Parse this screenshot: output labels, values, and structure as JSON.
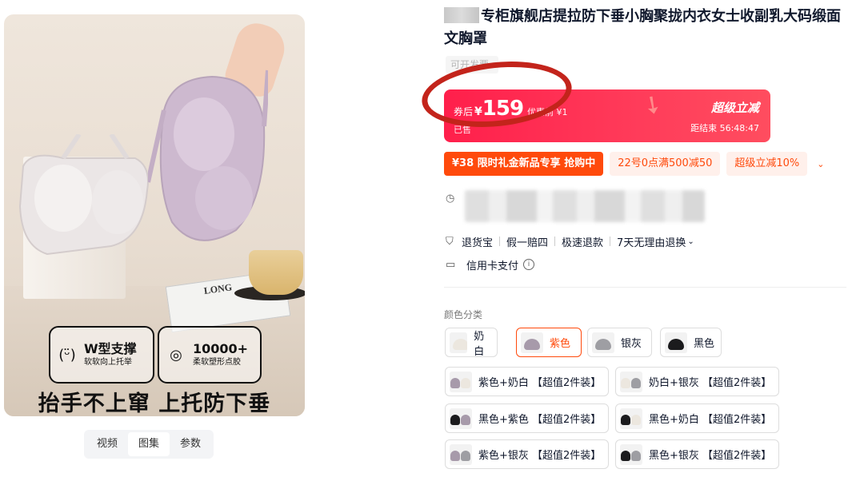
{
  "product": {
    "title": "专柜旗舰店提拉防下垂小胸聚拢内衣女士收副乳大码缎面文胸罩",
    "tag": "可开发票"
  },
  "gallery": {
    "feature1_title": "W型支撑",
    "feature1_sub": "软软向上托举",
    "feature2_title": "10000+",
    "feature2_sub": "柔软塑形点胶",
    "headline": "抬手不上窜  上托防下垂",
    "paper_text": "LONG",
    "tabs": [
      {
        "label": "视频"
      },
      {
        "label": "图集"
      },
      {
        "label": "参数"
      }
    ]
  },
  "price": {
    "after_label": "券后",
    "currency": "¥",
    "value": "159",
    "before_label": "优惠前 ¥1",
    "sold_text": "已售",
    "brand": "超级立减",
    "countdown": "距结束 56:48:47"
  },
  "promos": [
    {
      "label": "¥38  限时礼金新品专享 抢购中",
      "style": "solid"
    },
    {
      "label": "22号0点满500减50",
      "style": "light"
    },
    {
      "label": "超级立减10%",
      "style": "light"
    }
  ],
  "promos_chevron": "⌄",
  "services": {
    "items": [
      "退货宝",
      "假一赔四",
      "极速退款",
      "7天无理由退换"
    ],
    "more": "⌄",
    "credit": "信用卡支付",
    "info": "i"
  },
  "sku": {
    "label": "颜色分类",
    "singles": [
      {
        "label": "奶白",
        "c": "#ece7df"
      },
      {
        "label": "紫色",
        "c": "#a79aaa"
      },
      {
        "label": "银灰",
        "c": "#9e9ea3"
      },
      {
        "label": "黑色",
        "c": "#1b1b1d"
      }
    ],
    "doubles": [
      {
        "label": "紫色+奶白 【超值2件装】",
        "c1": "#a79aaa",
        "c2": "#ece7df"
      },
      {
        "label": "奶白+银灰 【超值2件装】",
        "c1": "#ece7df",
        "c2": "#9e9ea3"
      },
      {
        "label": "黑色+紫色 【超值2件装】",
        "c1": "#1b1b1d",
        "c2": "#a79aaa"
      },
      {
        "label": "黑色+奶白 【超值2件装】",
        "c1": "#1b1b1d",
        "c2": "#ece7df"
      },
      {
        "label": "紫色+银灰 【超值2件装】",
        "c1": "#a79aaa",
        "c2": "#9e9ea3"
      },
      {
        "label": "黑色+银灰 【超值2件装】",
        "c1": "#1b1b1d",
        "c2": "#9e9ea3"
      }
    ]
  }
}
